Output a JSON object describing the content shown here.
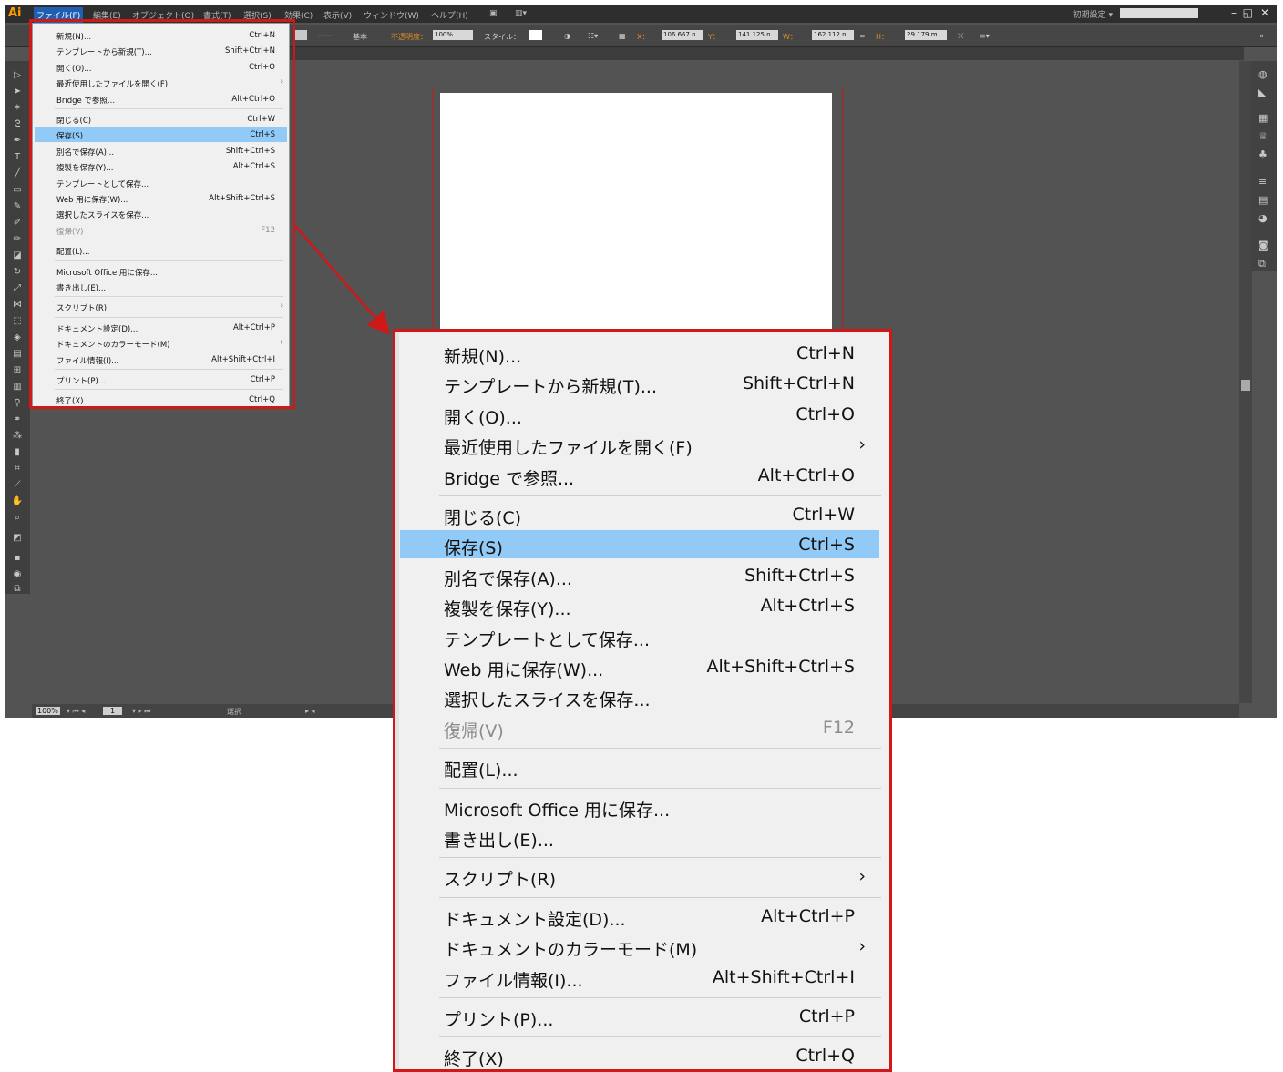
{
  "app": {
    "logo": "Ai",
    "menu_items": [
      "ファイル(F)",
      "編集(E)",
      "オブジェクト(O)",
      "書式(T)",
      "選択(S)",
      "効果(C)",
      "表示(V)",
      "ウィンドウ(W)",
      "ヘルプ(H)"
    ],
    "workspace": "初期設定 ▾"
  },
  "control_bar": {
    "stroke_label": "基本",
    "opacity_label": "不透明度：",
    "opacity_value": "100%",
    "style_label": "スタイル：",
    "x_label": "X：",
    "x_value": "106.667 n",
    "y_label": "Y：",
    "y_value": "141.125 n",
    "w_label": "W：",
    "w_value": "162.112 n",
    "h_label": "H：",
    "h_value": "29.179 m"
  },
  "status_bar": {
    "zoom": "100%",
    "page": "1",
    "mode": "選択"
  },
  "file_menu": {
    "items": [
      {
        "label": "新規(N)...",
        "shortcut": "Ctrl+N"
      },
      {
        "label": "テンプレートから新規(T)...",
        "shortcut": "Shift+Ctrl+N"
      },
      {
        "label": "開く(O)...",
        "shortcut": "Ctrl+O"
      },
      {
        "label": "最近使用したファイルを開く(F)",
        "shortcut": "",
        "arrow": "›"
      },
      {
        "label": "Bridge で参照...",
        "shortcut": "Alt+Ctrl+O"
      },
      {
        "label": "閉じる(C)",
        "shortcut": "Ctrl+W"
      },
      {
        "label": "保存(S)",
        "shortcut": "Ctrl+S"
      },
      {
        "label": "別名で保存(A)...",
        "shortcut": "Shift+Ctrl+S"
      },
      {
        "label": "複製を保存(Y)...",
        "shortcut": "Alt+Ctrl+S"
      },
      {
        "label": "テンプレートとして保存...",
        "shortcut": ""
      },
      {
        "label": "Web 用に保存(W)...",
        "shortcut": "Alt+Shift+Ctrl+S"
      },
      {
        "label": "選択したスライスを保存...",
        "shortcut": ""
      },
      {
        "label": "復帰(V)",
        "shortcut": "F12"
      },
      {
        "label": "配置(L)...",
        "shortcut": ""
      },
      {
        "label": "Microsoft Office 用に保存...",
        "shortcut": ""
      },
      {
        "label": "書き出し(E)...",
        "shortcut": ""
      },
      {
        "label": "スクリプト(R)",
        "shortcut": "",
        "arrow": "›"
      },
      {
        "label": "ドキュメント設定(D)...",
        "shortcut": "Alt+Ctrl+P"
      },
      {
        "label": "ドキュメントのカラーモード(M)",
        "shortcut": "",
        "arrow": "›"
      },
      {
        "label": "ファイル情報(I)...",
        "shortcut": "Alt+Shift+Ctrl+I"
      },
      {
        "label": "プリント(P)...",
        "shortcut": "Ctrl+P"
      },
      {
        "label": "終了(X)",
        "shortcut": "Ctrl+Q"
      }
    ],
    "highlighted_index": 6,
    "disabled_index": 12
  },
  "colors": {
    "highlight": "#91c9f7",
    "callout": "#d01818",
    "logo": "#ff9a00"
  }
}
